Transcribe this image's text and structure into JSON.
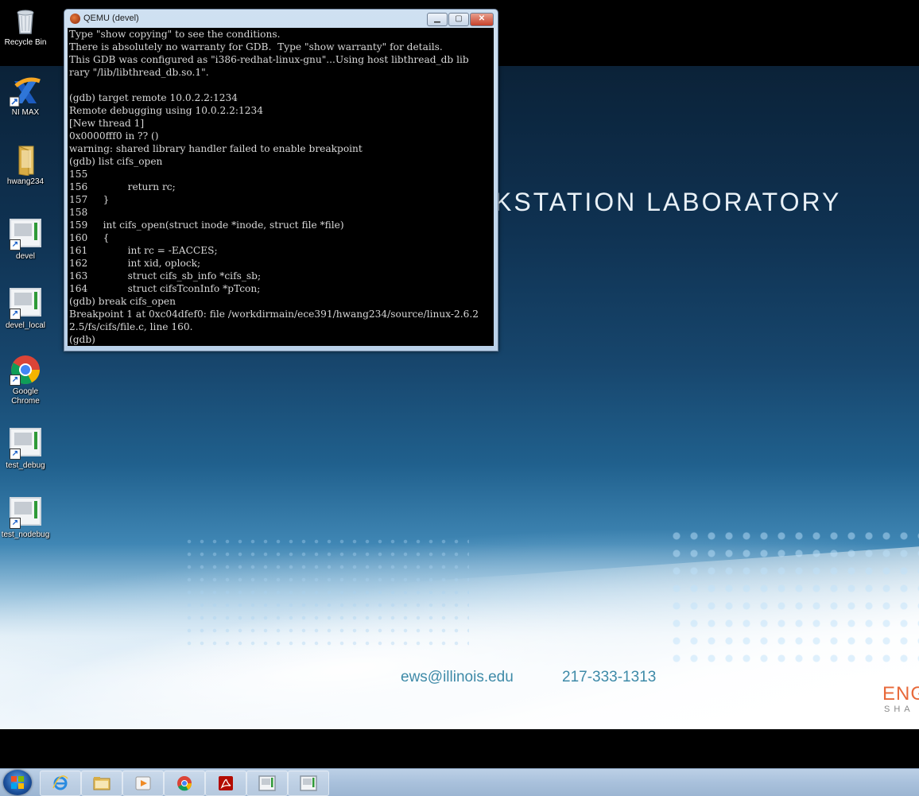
{
  "wallpaper": {
    "title": "KSTATION LABORATORY",
    "email": "ews@illinois.edu",
    "phone": "217-333-1313",
    "logo": "ENG",
    "logo_sub": "SHA"
  },
  "desktop_icons": [
    {
      "label": "Recycle Bin",
      "icon": "recycle-bin-icon"
    },
    {
      "label": "NI MAX",
      "icon": "ni-max-icon"
    },
    {
      "label": "hwang234",
      "icon": "folder-icon"
    },
    {
      "label": "devel",
      "icon": "qemu-shortcut-icon"
    },
    {
      "label": "devel_local",
      "icon": "qemu-shortcut-icon"
    },
    {
      "label": "Google Chrome",
      "icon": "chrome-icon"
    },
    {
      "label": "test_debug",
      "icon": "qemu-shortcut-icon"
    },
    {
      "label": "test_nodebug",
      "icon": "qemu-shortcut-icon"
    }
  ],
  "qemu_window": {
    "title": "QEMU (devel)",
    "terminal_lines": [
      "Type \"show copying\" to see the conditions.",
      "There is absolutely no warranty for GDB.  Type \"show warranty\" for details.",
      "This GDB was configured as \"i386-redhat-linux-gnu\"...Using host libthread_db lib",
      "rary \"/lib/libthread_db.so.1\".",
      "",
      "(gdb) target remote 10.0.2.2:1234",
      "Remote debugging using 10.0.2.2:1234",
      "[New thread 1]",
      "0x0000fff0 in ?? ()",
      "warning: shared library handler failed to enable breakpoint",
      "(gdb) list cifs_open",
      "155",
      "156             return rc;",
      "157     }",
      "158",
      "159     int cifs_open(struct inode *inode, struct file *file)",
      "160     {",
      "161             int rc = -EACCES;",
      "162             int xid, oplock;",
      "163             struct cifs_sb_info *cifs_sb;",
      "164             struct cifsTconInfo *pTcon;",
      "(gdb) break cifs_open",
      "Breakpoint 1 at 0xc04dfef0: file /workdirmain/ece391/hwang234/source/linux-2.6.2",
      "2.5/fs/cifs/file.c, line 160.",
      "(gdb)"
    ]
  },
  "taskbar": {
    "items": [
      {
        "name": "internet-explorer-icon"
      },
      {
        "name": "file-explorer-icon"
      },
      {
        "name": "media-player-icon"
      },
      {
        "name": "chrome-icon"
      },
      {
        "name": "acrobat-icon"
      },
      {
        "name": "qemu-window-icon"
      },
      {
        "name": "qemu-window-icon"
      }
    ]
  }
}
